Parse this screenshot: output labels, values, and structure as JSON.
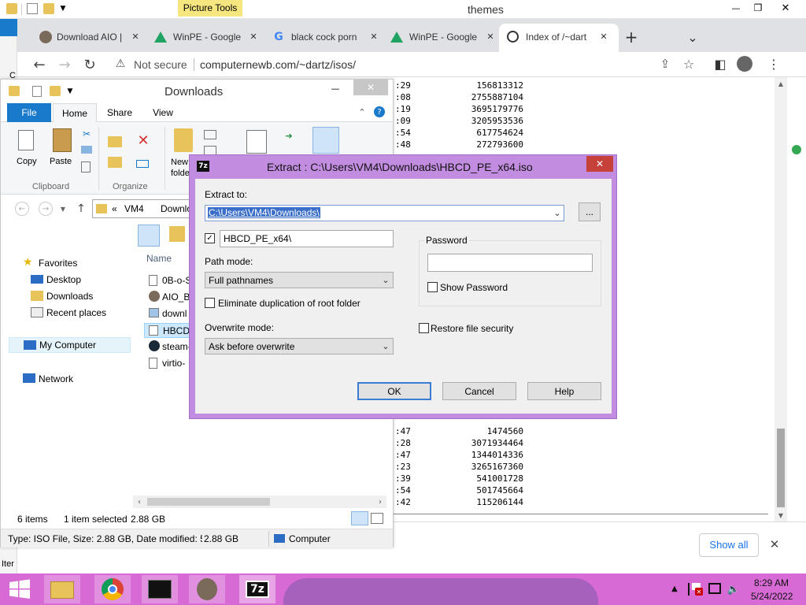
{
  "top_bar": {
    "title": "themes",
    "picture_tools": "Picture Tools",
    "min": "—",
    "max": "❐",
    "close": "✕"
  },
  "chrome": {
    "tabs": [
      {
        "title": "Download AIO |"
      },
      {
        "title": "WinPE - Google"
      },
      {
        "title": "black cock porn"
      },
      {
        "title": "WinPE - Google"
      },
      {
        "title": "Index of /~dart"
      }
    ],
    "new_tab": "+",
    "tab_list": "⌄",
    "not_secure": "Not secure",
    "url": "computernewb.com/~dartz/isos/",
    "show_all": "Show all"
  },
  "listing": {
    "rows": [
      {
        "t": ":29",
        "s": "156813312"
      },
      {
        "t": ":08",
        "s": "2755887104"
      },
      {
        "t": ":19",
        "s": "3695179776"
      },
      {
        "t": ":09",
        "s": "3205953536"
      },
      {
        "t": ":54",
        "s": "617754624"
      },
      {
        "t": ":48",
        "s": "272793600"
      }
    ],
    "rows2": [
      {
        "t": ":47",
        "s": "1474560"
      },
      {
        "t": ":28",
        "s": "3071934464"
      },
      {
        "t": ":47",
        "s": "1344014336"
      },
      {
        "t": ":23",
        "s": "3265167360"
      },
      {
        "t": ":39",
        "s": "541001728"
      },
      {
        "t": ":54",
        "s": "501745664"
      },
      {
        "t": ":42",
        "s": "115206144"
      }
    ]
  },
  "explorer": {
    "title": "Downloads",
    "ribbon_tabs": {
      "file": "File",
      "home": "Home",
      "share": "Share",
      "view": "View"
    },
    "copy": "Copy",
    "paste": "Paste",
    "new_folder": "New\nfolder",
    "clipboard": "Clipboard",
    "organize": "Organize",
    "crumb_prefix": "«",
    "crumb_vm4": "VM4",
    "crumb_downloads": "Downlo",
    "col_name": "Name",
    "nav": {
      "favorites": "Favorites",
      "desktop": "Desktop",
      "downloads": "Downloads",
      "recent": "Recent places",
      "my_computer": "My Computer",
      "network": "Network"
    },
    "files": [
      "0B-o-S",
      "AIO_Bo",
      "downl",
      "HBCD_",
      "steam-",
      "virtio-"
    ],
    "status": {
      "items": "6 items",
      "selected": "1 item selected",
      "size": "2.88 GB"
    },
    "details": {
      "type": "Type: ISO File, Size: 2.88 GB, Date modified: 5/2",
      "size": "2.88 GB",
      "computer": "Computer"
    }
  },
  "dialog": {
    "icon": "7z",
    "title": "Extract : C:\\Users\\VM4\\Downloads\\HBCD_PE_x64.iso",
    "extract_to_label": "Extract to:",
    "extract_to_value": "C:\\Users\\VM4\\Downloads\\",
    "browse": "...",
    "subfolder": "HBCD_PE_x64\\",
    "path_mode_label": "Path mode:",
    "path_mode_value": "Full pathnames",
    "eliminate_label": "Eliminate duplication of root folder",
    "overwrite_label": "Overwrite mode:",
    "overwrite_value": "Ask before overwrite",
    "password_group": "Password",
    "show_password": "Show Password",
    "restore_security": "Restore file security",
    "ok": "OK",
    "cancel": "Cancel",
    "help": "Help",
    "close": "✕"
  },
  "left_stub": {
    "c": "C",
    "iter": "Iter"
  },
  "taskbar": {
    "time": "8:29 AM",
    "date": "5/24/2022",
    "sevenzip": "7z"
  }
}
